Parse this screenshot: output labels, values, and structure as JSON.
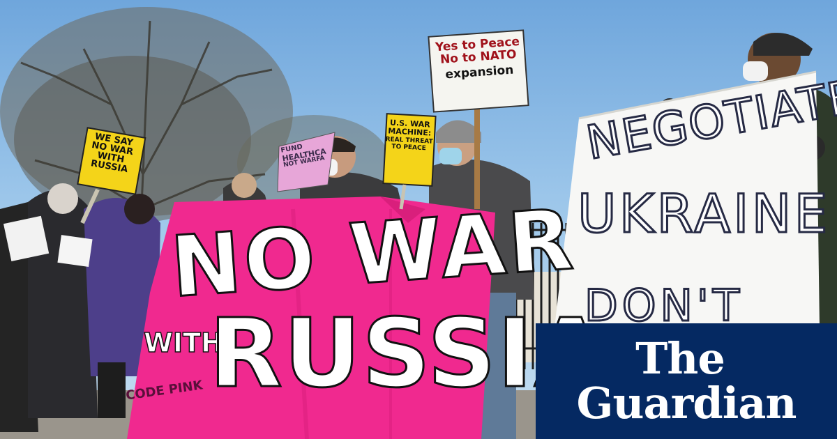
{
  "image": {
    "description_free": true
  },
  "signs": {
    "peace_line1": "Yes to Peace",
    "peace_line2": "No to NATO",
    "peace_line3": "expansion",
    "we_say_line1": "WE SAY",
    "we_say_line2": "NO WAR",
    "we_say_line3": "WITH",
    "we_say_line4": "RUSSIA",
    "war_machine_line1": "U.S. WAR",
    "war_machine_line2": "MACHINE:",
    "war_machine_line3": "REAL THREAT",
    "war_machine_line4": "TO PEACE",
    "fund_line1": "FUND",
    "fund_line2": "HEALTHCA",
    "fund_line3": "NOT WARFA",
    "banner_line1": "NO WAR",
    "banner_with": "WITH",
    "banner_line2": "RUSSIA",
    "banner_credit": "CODE PINK",
    "negotiate_line1": "NEGOTIATE",
    "negotiate_line2": "UKRAINE",
    "negotiate_line3": "DON'T"
  },
  "logo": {
    "line1": "The",
    "line2": "Guardian"
  },
  "colors": {
    "banner_pink": "#f0298f",
    "sign_yellow": "#f4d419",
    "guardian_blue": "#052962"
  }
}
